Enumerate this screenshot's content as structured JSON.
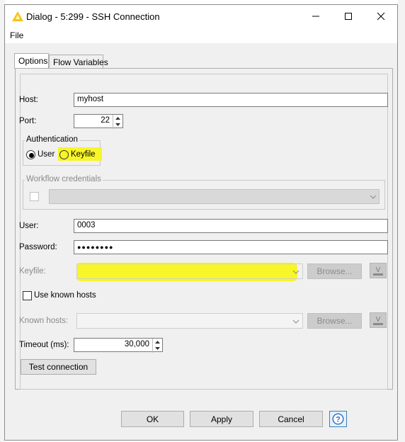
{
  "window": {
    "title": "Dialog - 5:299 - SSH Connection",
    "menu_file": "File"
  },
  "tabs": [
    {
      "label": "Options"
    },
    {
      "label": "Flow Variables"
    }
  ],
  "host": {
    "label": "Host:",
    "value": "myhost"
  },
  "port": {
    "label": "Port:",
    "value": "22"
  },
  "authentication": {
    "title": "Authentication",
    "option_user": "User",
    "option_keyfile": "Keyfile",
    "selected": "User"
  },
  "workflow_credentials": {
    "title": "Workflow credentials"
  },
  "user": {
    "label": "User:",
    "value": "0003"
  },
  "password": {
    "label": "Password:",
    "value": "●●●●●●●●"
  },
  "keyfile": {
    "label": "Keyfile:",
    "browse_label": "Browse..."
  },
  "use_known_hosts": {
    "label": "Use known hosts",
    "checked": false
  },
  "known_hosts": {
    "label": "Known hosts:",
    "browse_label": "Browse..."
  },
  "timeout": {
    "label": "Timeout (ms):",
    "value": "30,000"
  },
  "test_connection": {
    "label": "Test connection"
  },
  "footer": {
    "ok": "OK",
    "apply": "Apply",
    "cancel": "Cancel"
  },
  "colors": {
    "highlight": "#f8f528",
    "warning_icon": "#f5c518"
  }
}
